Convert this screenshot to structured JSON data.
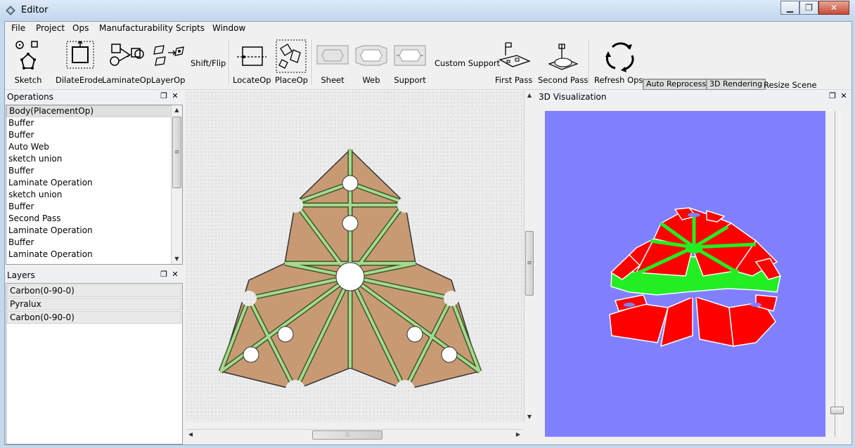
{
  "window": {
    "title": "Editor",
    "minimize_icon": "minimize-icon",
    "maximize_icon": "maximize-icon",
    "close_icon": "close-icon"
  },
  "menu": [
    "File",
    "Project",
    "Ops",
    "Manufacturability",
    "Scripts",
    "Window"
  ],
  "toolbar": {
    "sketch": "Sketch",
    "dilate_erode": "DilateErode",
    "laminate_op": "LaminateOp",
    "layer_op": "LayerOp",
    "shift_flip": "Shift/Flip",
    "locate_op": "LocateOp",
    "place_op": "PlaceOp",
    "sheet": "Sheet",
    "web": "Web",
    "support": "Support",
    "custom_support": "Custom Support",
    "first_pass": "First Pass",
    "second_pass": "Second Pass",
    "refresh_ops": "Refresh Ops",
    "auto_reprocess": "Auto Reprocess",
    "rendering_3d": "3D Rendering",
    "resize_scene": "Resize Scene"
  },
  "operations_panel": {
    "title": "Operations",
    "items": [
      "Body(PlacementOp)",
      "Buffer",
      "Buffer",
      "Auto Web",
      "sketch union",
      "Buffer",
      "Laminate Operation",
      "sketch union",
      "Buffer",
      "Second Pass",
      "Laminate Operation",
      "Buffer",
      "Laminate Operation"
    ]
  },
  "layers_panel": {
    "title": "Layers",
    "items": [
      "Carbon(0-90-0)",
      "Pyralux",
      "Carbon(0-90-0)"
    ]
  },
  "viz_panel": {
    "title": "3D Visualization"
  },
  "colors": {
    "laminate_fill": "#c89a74",
    "hinge_green": "#9fd08a",
    "viz_background": "#8080ff",
    "viz_red": "#ff0000",
    "viz_green": "#22ee22"
  }
}
